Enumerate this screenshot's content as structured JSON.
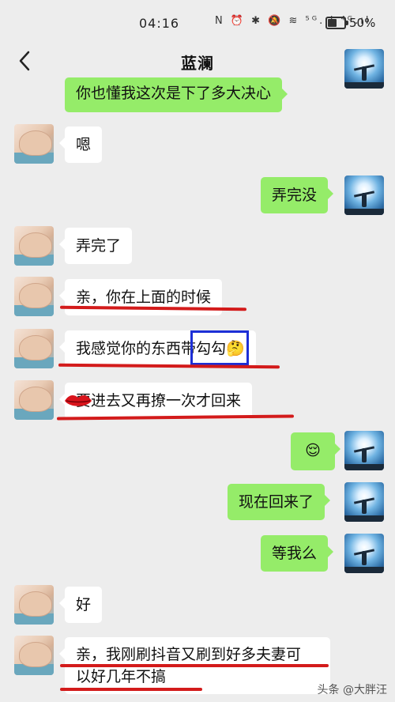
{
  "status_bar": {
    "time": "04:16",
    "icons_text": "N ⏰ ✱ 🔕 ≋ ⁵ᴳ.ıl ⁴ᴳ.ıl",
    "battery": "50%"
  },
  "header": {
    "title": "蓝澜",
    "more": "•••"
  },
  "messages": [
    {
      "side": "right",
      "text": "你也懂我这次是下了多大决心"
    },
    {
      "side": "left",
      "text": "嗯"
    },
    {
      "side": "right",
      "text": "弄完没"
    },
    {
      "side": "left",
      "text": "弄完了"
    },
    {
      "side": "left",
      "text": "亲，你在上面的时候"
    },
    {
      "side": "left",
      "text": "我感觉你的东西带勾勾",
      "emoji": "🤔"
    },
    {
      "side": "left",
      "text": "要进去又再撩一次才回来"
    },
    {
      "side": "right",
      "text": "",
      "emoji": "😌"
    },
    {
      "side": "right",
      "text": "现在回来了"
    },
    {
      "side": "right",
      "text": "等我么"
    },
    {
      "side": "left",
      "text": "好"
    },
    {
      "side": "left",
      "text_line1": "亲，我刚刷抖音又刷到好多夫妻可",
      "text_line2": "以好几年不搞"
    }
  ],
  "watermark": "头条 @大胖汪",
  "colors": {
    "background": "#ededed",
    "bubble_sent": "#95ec69",
    "bubble_received": "#ffffff",
    "annotation_red": "#d31b1b",
    "annotation_blue": "#1d2fd6"
  }
}
